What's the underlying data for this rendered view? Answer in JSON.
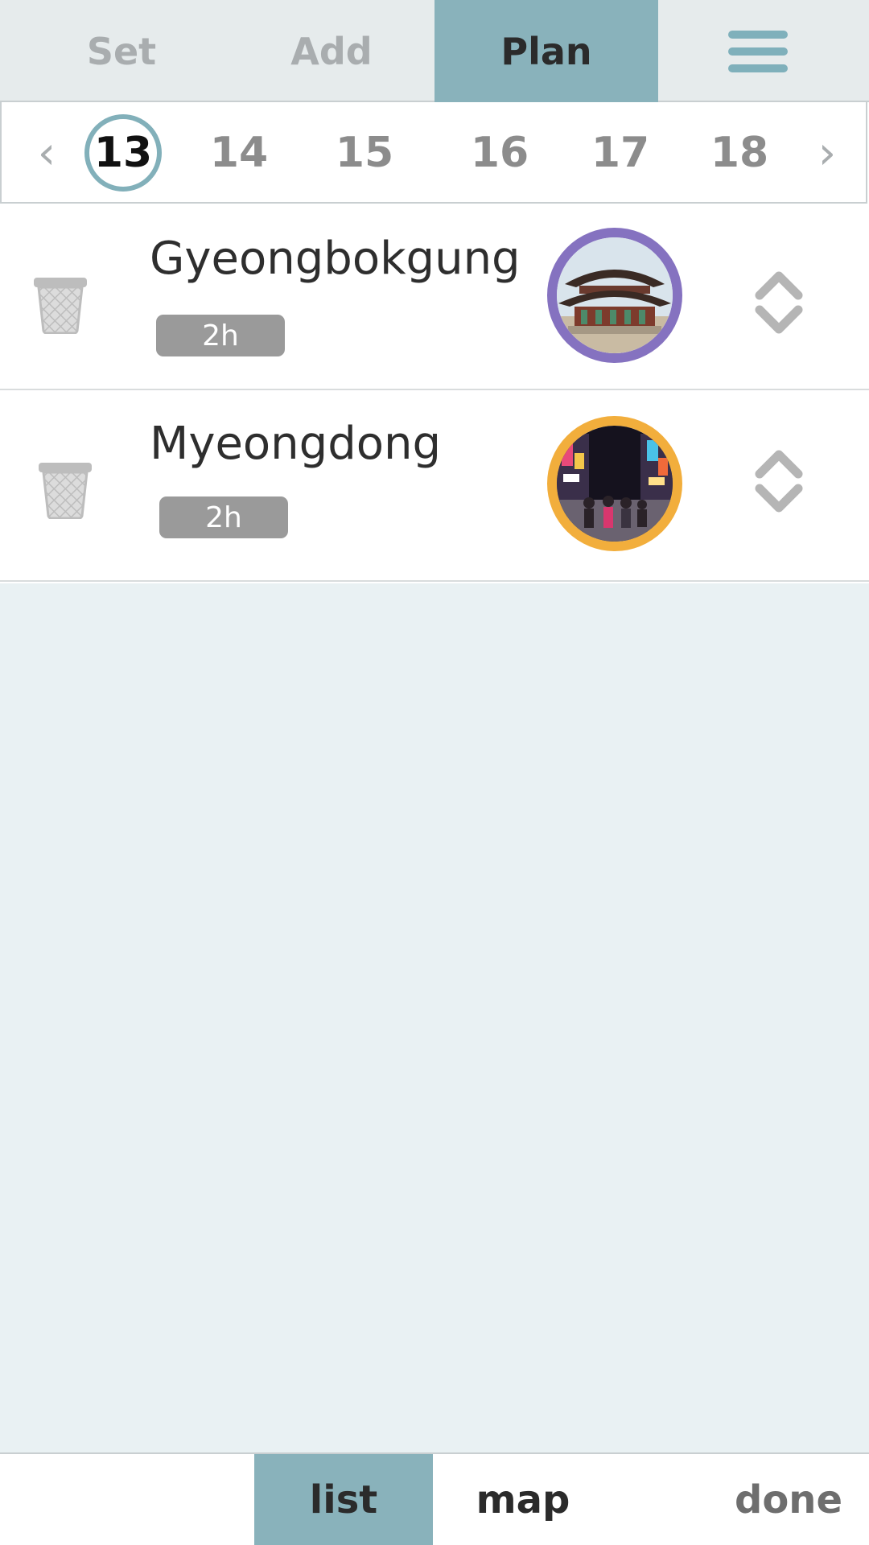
{
  "tabs": {
    "set": "Set",
    "add": "Add",
    "plan": "Plan",
    "active": "plan"
  },
  "menu_icon": "hamburger-menu-icon",
  "day_selector": {
    "prev_icon": "chevron-left-icon",
    "next_icon": "chevron-right-icon",
    "prev_glyph": "‹",
    "next_glyph": "›",
    "days": [
      "13",
      "14",
      "15",
      "16",
      "17",
      "18"
    ],
    "selected": "13",
    "selected_ring_color": "#82b0ba"
  },
  "plan_items": [
    {
      "title": "Gyeongbokgung",
      "duration": "2h",
      "thumb_ring_color": "#8572c0",
      "thumb_icon": "palace-photo",
      "delete_icon": "trash-icon",
      "reorder_icon": "reorder-arrows-icon"
    },
    {
      "title": "Myeongdong",
      "duration": "2h",
      "thumb_ring_color": "#f2ae3c",
      "thumb_icon": "street-photo",
      "delete_icon": "trash-icon",
      "reorder_icon": "reorder-arrows-icon"
    }
  ],
  "bottom_tabs": {
    "list": "list",
    "map": "map",
    "done": "done",
    "active": "list"
  },
  "colors": {
    "accent": "#89b2bb",
    "top_bar_bg": "#e6ebec",
    "empty_area_bg": "#e9f1f3",
    "duration_badge": "#9a9a9a"
  }
}
